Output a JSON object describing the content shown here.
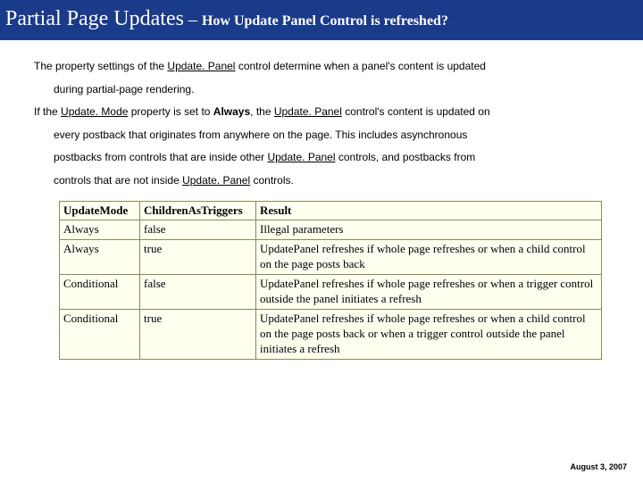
{
  "title": {
    "main": "Partial Page Updates",
    "sep": " – ",
    "sub": "How Update Panel Control is refreshed?"
  },
  "body": {
    "p1_a": "The property settings of the ",
    "p1_link1": "Update. Panel",
    "p1_b": " control determine when a panel's content is updated",
    "p1_c": "during partial-page rendering.",
    "p2_a": "If the ",
    "p2_link1": "Update. Mode",
    "p2_b": " property is set to ",
    "p2_bold": "Always",
    "p2_c": ", the ",
    "p2_link2": "Update. Panel",
    "p2_d": " control's content is updated on",
    "p2_e": "every postback that originates from anywhere on the page. This includes asynchronous",
    "p2_f": "postbacks from controls that are inside other ",
    "p2_link3": "Update. Panel",
    "p2_g": " controls, and postbacks from",
    "p2_h": "controls that are not inside ",
    "p2_link4": "Update. Panel",
    "p2_i": " controls."
  },
  "table": {
    "headers": [
      "UpdateMode",
      "ChildrenAsTriggers",
      "Result"
    ],
    "rows": [
      {
        "mode": "Always",
        "children": "false",
        "result": "Illegal parameters"
      },
      {
        "mode": "Always",
        "children": "true",
        "result": "UpdatePanel refreshes if whole page refreshes or when a child control on the page posts back"
      },
      {
        "mode": "Conditional",
        "children": "false",
        "result": "UpdatePanel refreshes if whole page refreshes or when a trigger control outside the panel initiates a refresh"
      },
      {
        "mode": "Conditional",
        "children": "true",
        "result": "UpdatePanel refreshes if whole page refreshes or when a child control on the page posts back or when a trigger control outside the panel initiates a refresh"
      }
    ]
  },
  "footer": {
    "date": "August 3, 2007"
  }
}
